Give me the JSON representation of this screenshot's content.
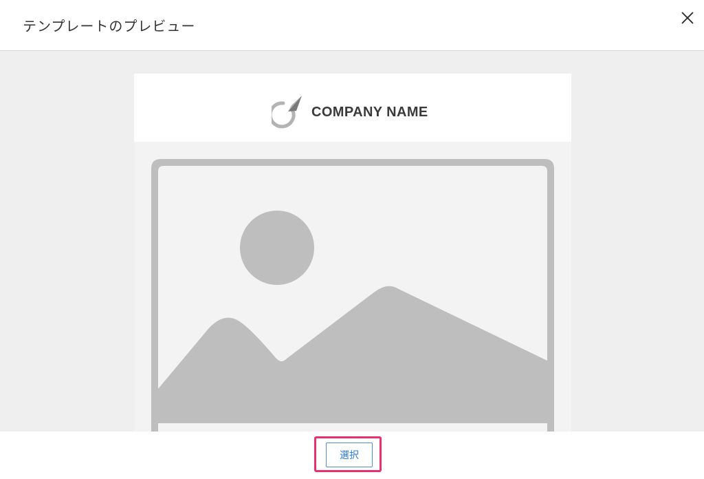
{
  "modal": {
    "title": "テンプレートのプレビュー",
    "close_icon": "close-icon"
  },
  "preview": {
    "company_name": "COMPANY NAME",
    "logo_icon": "logo-icon",
    "hero_icon": "image-placeholder-icon"
  },
  "footer": {
    "select_label": "選択",
    "highlight_color": "#e8316e",
    "button_color": "#2a7ad5"
  }
}
